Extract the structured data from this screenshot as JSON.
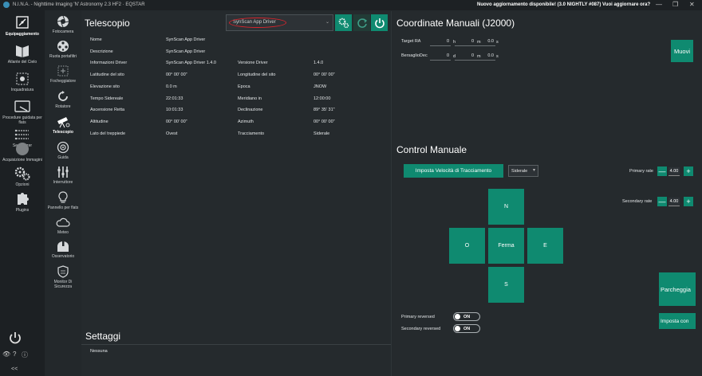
{
  "window": {
    "title": "N.I.N.A. - Nighttime Imaging 'N' Astronomy 2.3 HF2 · EQSTAR",
    "update_notice": "Nuovo aggiornamento disponibile! (3.0 NIGHTLY #087) Vuoi aggiornare ora?",
    "minimize": "—",
    "maximize": "❐",
    "close": "✕"
  },
  "main_nav": [
    {
      "label": "Equipaggiamento",
      "icon": "camera-icon"
    },
    {
      "label": "Atlante del Cielo",
      "icon": "sky-atlas-icon"
    },
    {
      "label": "Inquadratura",
      "icon": "framing-icon"
    },
    {
      "label": "Procedure guidata per flats",
      "icon": "flat-wizard-icon"
    },
    {
      "label": "Sequenzer",
      "icon": "sequencer-icon"
    },
    {
      "label": "Acquisizione Immagini",
      "icon": "imaging-icon"
    },
    {
      "label": "Opzioni",
      "icon": "gears-icon"
    },
    {
      "label": "Plugins",
      "icon": "puzzle-icon"
    }
  ],
  "equipment_nav": [
    {
      "label": "Fotocamera"
    },
    {
      "label": "Ruota portafiltri"
    },
    {
      "label": "Focheggiatore"
    },
    {
      "label": "Rotatore"
    },
    {
      "label": "Telescopio"
    },
    {
      "label": "Guida"
    },
    {
      "label": "Interruttore"
    },
    {
      "label": "Pannello per flats"
    },
    {
      "label": "Meteo"
    },
    {
      "label": "Osservatorio"
    },
    {
      "label": "Monitor Di Sicurezza"
    }
  ],
  "footer": {
    "collapse": "<<"
  },
  "telescope": {
    "title": "Telescopio",
    "driver_select": "SynScan App Driver",
    "info_rows": [
      {
        "label": "Nome",
        "value": "SynScan App Driver"
      },
      {
        "label": "Descrizione",
        "value": "SynScan App Driver"
      },
      {
        "label": "Informazioni Driver",
        "value": "SynScan App Driver 1.4.0",
        "label2": "Versione Driver",
        "value2": "1.4.0"
      },
      {
        "label": "Latitudine del sito",
        "value": "00° 00' 00\"",
        "label2": "Longitudine del sito",
        "value2": "00° 00' 00\""
      },
      {
        "label": "Elevazione sito",
        "value": "0.0 m",
        "label2": "Epoca",
        "value2": "JNOW"
      },
      {
        "label": "Tempo Sidereale",
        "value": "22:01:33",
        "label2": "Meridiano in",
        "value2": "12:00:00"
      },
      {
        "label": "Ascensione Retta",
        "value": "10:01:33",
        "label2": "Declinazione",
        "value2": "89° 35' 31\""
      },
      {
        "label": "Altitudine",
        "value": "00° 00' 00\"",
        "label2": "Azimuth",
        "value2": "00° 00' 00\""
      },
      {
        "label": "Lato del treppiede",
        "value": "Ovest",
        "label2": "Tracciamento",
        "value2": "Siderale"
      }
    ]
  },
  "settings": {
    "title": "Settaggi",
    "none": "Nessuna"
  },
  "manual_coords": {
    "title": "Coordinate Manuali (J2000)",
    "ra_label": "Target RA",
    "dec_label": "BersaglioDec",
    "ra": {
      "h": "0",
      "m": "0",
      "s": "0.0"
    },
    "dec": {
      "d": "0",
      "m": "0",
      "s": "0.0"
    },
    "units": {
      "h": "h",
      "d": "d",
      "m": "m",
      "s": "s"
    },
    "move_button": "Muovi"
  },
  "manual_control": {
    "title": "Control Manuale",
    "tracking_button": "Imposta Velocità di Tracciamento",
    "tracking_mode": "Siderale",
    "primary_rate_label": "Primary rate",
    "primary_rate": "4.00",
    "secondary_rate_label": "Secondary rate",
    "secondary_rate": "4.00",
    "minus": "—",
    "plus": "+",
    "north": "N",
    "south": "S",
    "east": "E",
    "west": "O",
    "stop": "Ferma",
    "primary_reversed_label": "Primary reversed",
    "secondary_reversed_label": "Secondary reversed",
    "primary_reversed": "ON",
    "secondary_reversed": "ON",
    "park_button": "Parcheggia",
    "set_park_button": "Imposta con"
  }
}
